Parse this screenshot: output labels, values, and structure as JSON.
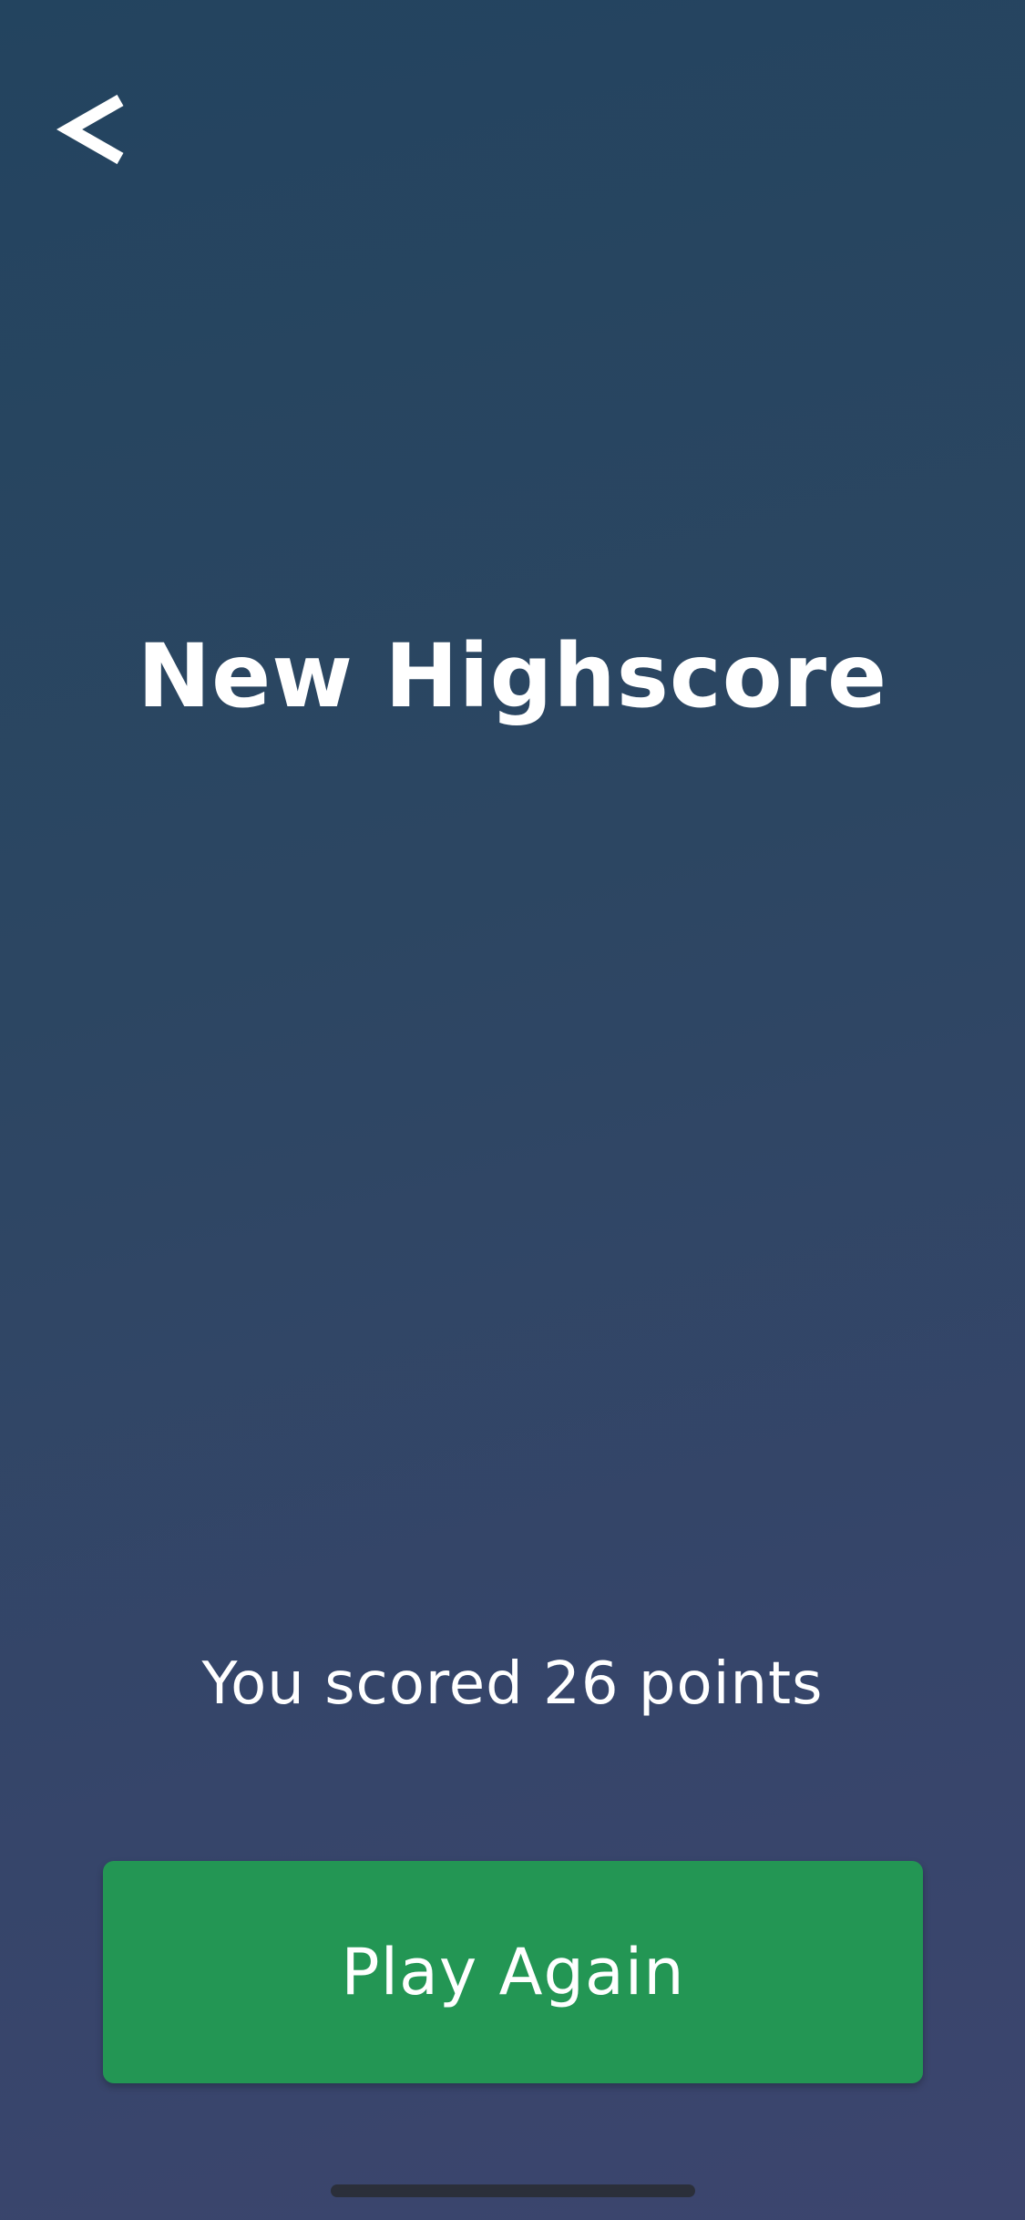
{
  "header": {
    "back_icon": "chevron-left-icon"
  },
  "main": {
    "title": "New Highscore",
    "score_message": "You scored 26 points"
  },
  "actions": {
    "play_again_label": "Play Again"
  },
  "colors": {
    "background_top": "#23445f",
    "background_bottom": "#3c456e",
    "button_green": "#239654",
    "text": "#ffffff"
  }
}
